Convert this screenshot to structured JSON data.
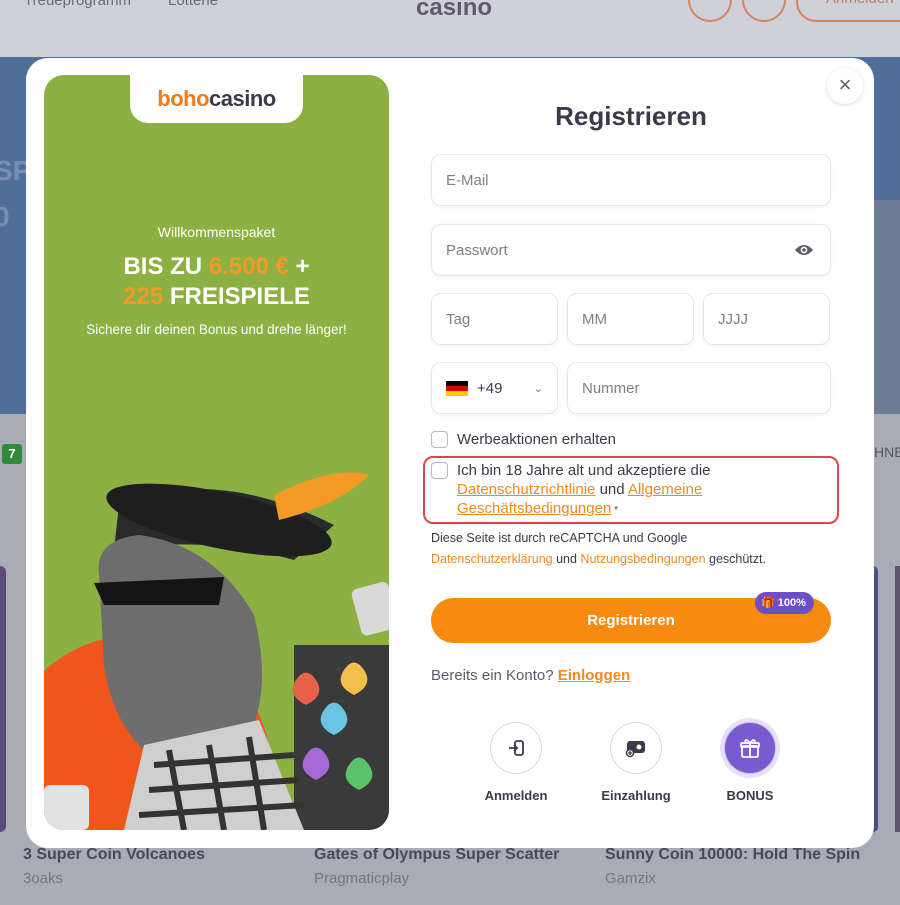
{
  "background": {
    "nav_left": "Treueprogramm",
    "nav_left2": "Lotterie",
    "logo": "casino",
    "login": "Anmelden",
    "hero_text_1": "SPA",
    "hero_text_2": "0",
    "badge": "7",
    "right_edge_text": "HNE",
    "games": [
      {
        "title": "3 Super Coin Volcanoes",
        "provider": "3oaks"
      },
      {
        "title": "Gates of Olympus Super Scatter",
        "provider": "Pragmaticplay"
      },
      {
        "title": "Sunny Coin 10000: Hold The Spin",
        "provider": "Gamzix"
      }
    ]
  },
  "promo": {
    "logo_boho": "boho",
    "logo_casino": "casino",
    "welcome": "Willkommenspaket",
    "line1_pre": "BIS ZU ",
    "line1_amount": "6.500 €",
    "line1_post": " +",
    "line2_count": "225",
    "line2_post": " FREISPIELE",
    "subtitle": "Sichere dir deinen Bonus und drehe länger!"
  },
  "form": {
    "title": "Registrieren",
    "email_placeholder": "E-Mail",
    "password_placeholder": "Passwort",
    "day_placeholder": "Tag",
    "month_placeholder": "MM",
    "year_placeholder": "JJJJ",
    "phone_prefix": "+49",
    "phone_placeholder": "Nummer",
    "promo_checkbox": "Werbeaktionen erhalten",
    "consent_pre": "Ich bin 18 Jahre alt und akzeptiere die",
    "consent_link1": "Datenschutzrichtlinie",
    "consent_mid": " und ",
    "consent_link2": "Allgemeine Geschäftsbedingungen",
    "consent_post": " *",
    "recaptcha_pre": "Diese Seite ist durch reCAPTCHA und Google",
    "recaptcha_link1": "Datenschutzerklärung",
    "recaptcha_mid": " und ",
    "recaptcha_link2": "Nutzungsbedingungen",
    "recaptcha_post": " geschützt.",
    "submit": "Registrieren",
    "bonus_pill": "100%",
    "already_text": "Bereits ein Konto?",
    "login_link": "Einloggen"
  },
  "quick_actions": [
    {
      "label": "Anmelden",
      "icon": "login-icon"
    },
    {
      "label": "Einzahlung",
      "icon": "wallet-icon"
    },
    {
      "label": "BONUS",
      "icon": "gift-icon"
    }
  ],
  "colors": {
    "accent_orange": "#f98a10",
    "promo_green": "#8db043",
    "bonus_purple": "#7a5ad0",
    "error_red": "#e1434b"
  }
}
